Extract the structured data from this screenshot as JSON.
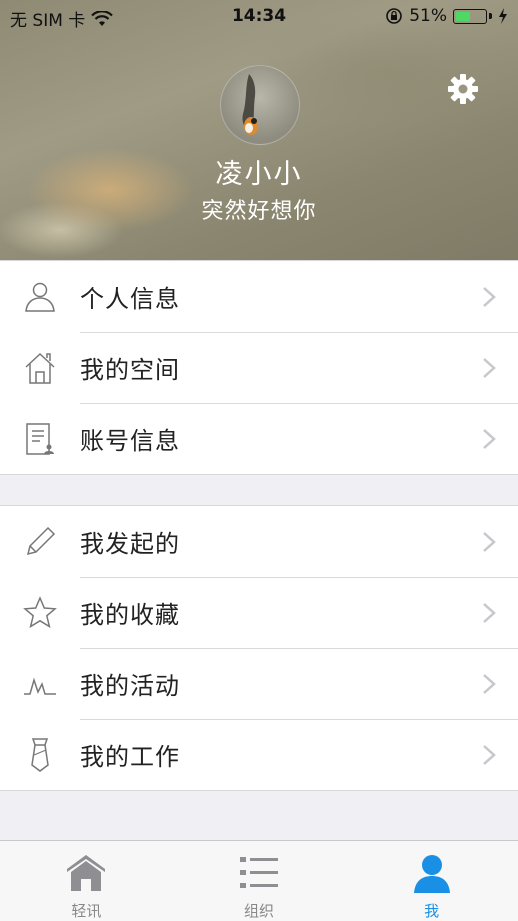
{
  "status_bar": {
    "carrier": "无 SIM 卡",
    "time": "14:34",
    "battery_percent": "51%",
    "battery_level": 0.51
  },
  "profile": {
    "name": "凌小小",
    "signature": "突然好想你"
  },
  "menu_group_1": [
    {
      "label": "个人信息",
      "icon": "person-icon"
    },
    {
      "label": "我的空间",
      "icon": "house-icon"
    },
    {
      "label": "账号信息",
      "icon": "account-document-icon"
    }
  ],
  "menu_group_2": [
    {
      "label": "我发起的",
      "icon": "pencil-icon"
    },
    {
      "label": "我的收藏",
      "icon": "star-icon"
    },
    {
      "label": "我的活动",
      "icon": "activity-wave-icon"
    },
    {
      "label": "我的工作",
      "icon": "tie-icon"
    }
  ],
  "tabs": [
    {
      "label": "轻讯",
      "icon": "home-icon",
      "active": false
    },
    {
      "label": "组织",
      "icon": "list-icon",
      "active": false
    },
    {
      "label": "我",
      "icon": "me-person-icon",
      "active": true
    }
  ],
  "colors": {
    "accent": "#1a8fe6",
    "battery": "#4cd964",
    "background": "#efeff4"
  }
}
